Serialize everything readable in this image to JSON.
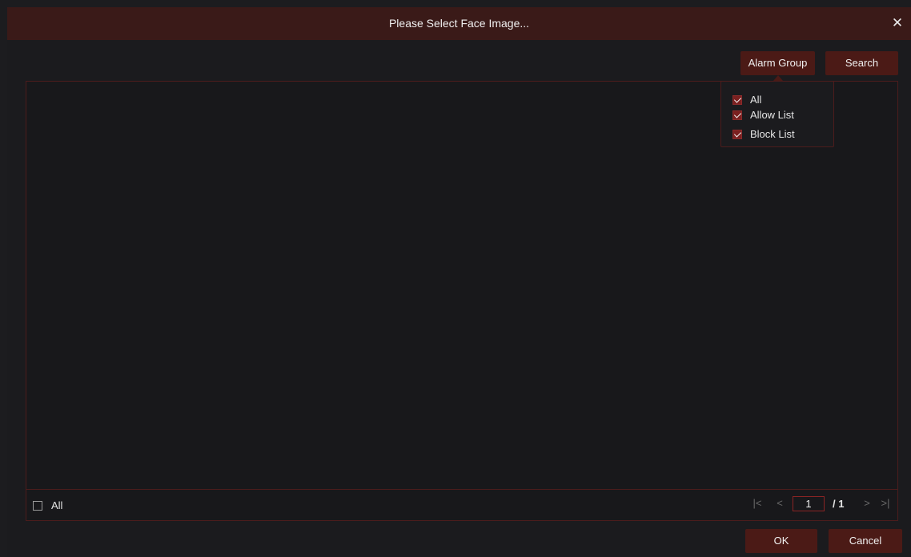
{
  "dialog": {
    "title": "Please Select Face Image...",
    "close_glyph": "✕"
  },
  "toolbar": {
    "alarm_group_label": "Alarm Group",
    "search_label": "Search"
  },
  "alarm_group_menu": {
    "items": [
      {
        "label": "All",
        "checked": true
      },
      {
        "label": "Allow List",
        "checked": true
      },
      {
        "label": "Block List",
        "checked": true
      }
    ]
  },
  "footer": {
    "select_all_label": "All",
    "select_all_checked": false,
    "pagination": {
      "first_glyph": "|<",
      "prev_glyph": "<",
      "current_page": "1",
      "total_text": "/ 1",
      "next_glyph": ">",
      "last_glyph": ">|"
    }
  },
  "actions": {
    "ok_label": "OK",
    "cancel_label": "Cancel"
  },
  "colors": {
    "titlebar": "#3a1a18",
    "button": "#4b1a16",
    "border": "#4c1c1c",
    "check": "#7a2020"
  }
}
